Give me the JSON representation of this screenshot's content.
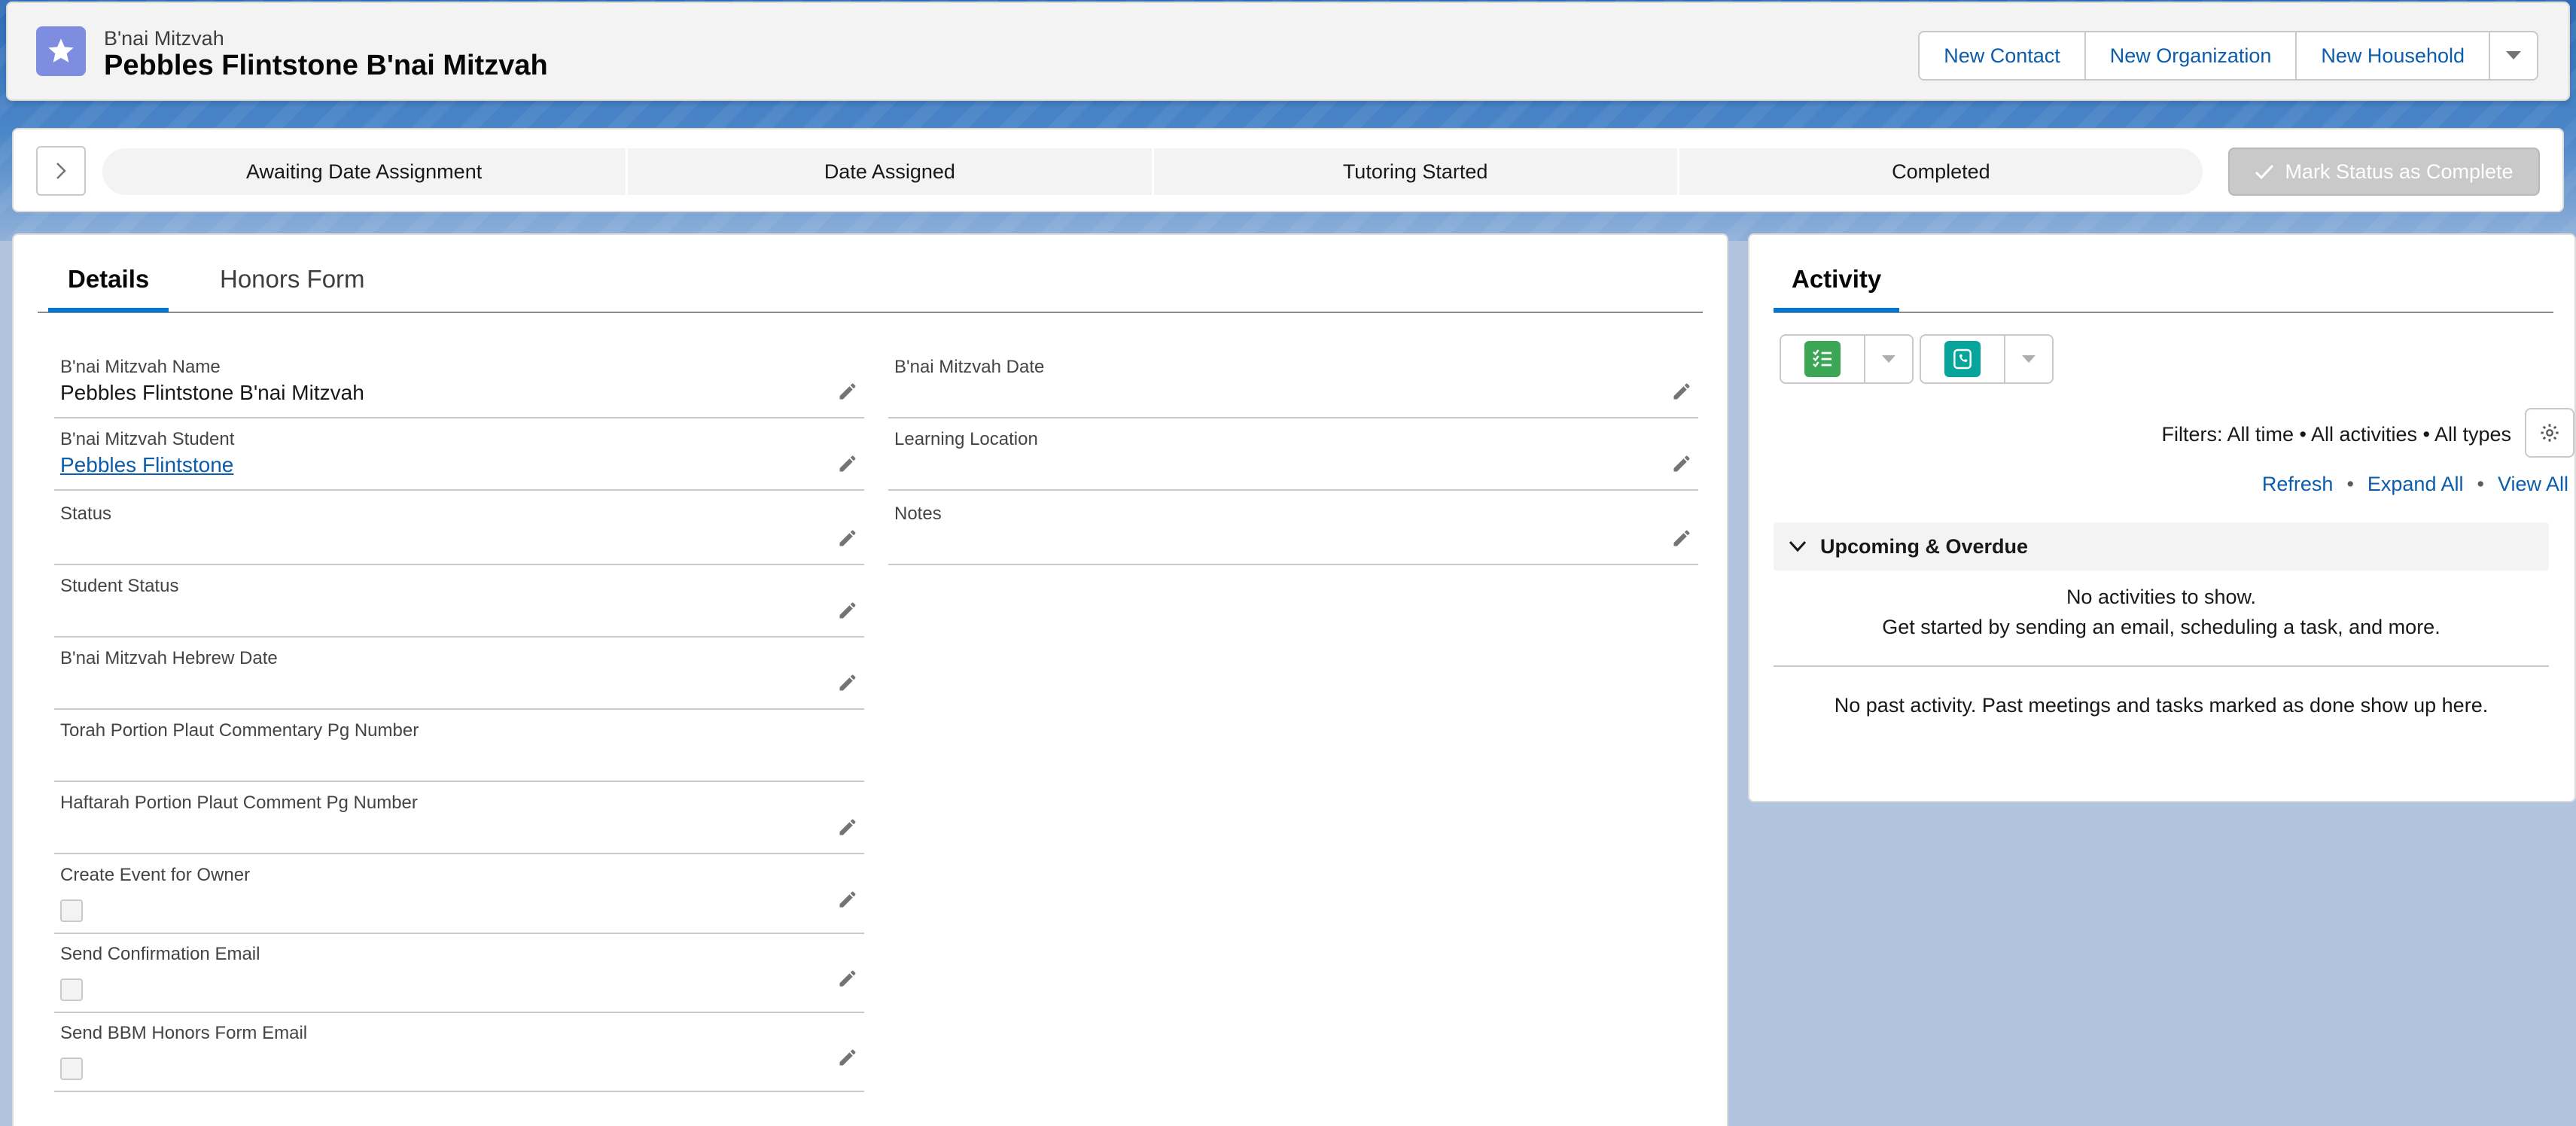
{
  "header": {
    "object_type": "B'nai Mitzvah",
    "record_title": "Pebbles Flintstone B'nai Mitzvah",
    "actions": [
      "New Contact",
      "New Organization",
      "New Household"
    ],
    "icon": "star-icon",
    "icon_color": "#7f8de1"
  },
  "path": {
    "stages": [
      "Awaiting Date Assignment",
      "Date Assigned",
      "Tutoring Started",
      "Completed"
    ],
    "mark_complete_label": "Mark Status as Complete"
  },
  "details": {
    "tabs": [
      "Details",
      "Honors Form"
    ],
    "left_fields": [
      {
        "label": "B'nai Mitzvah Name",
        "value": "Pebbles Flintstone B'nai Mitzvah"
      },
      {
        "label": "B'nai Mitzvah Student",
        "value": "Pebbles Flintstone"
      },
      {
        "label": "Status",
        "value": ""
      },
      {
        "label": "Student Status",
        "value": ""
      },
      {
        "label": "B'nai Mitzvah Hebrew Date",
        "value": ""
      },
      {
        "label": "Torah Portion Plaut Commentary Pg Number",
        "value": ""
      },
      {
        "label": "Haftarah Portion Plaut Comment Pg Number",
        "value": ""
      },
      {
        "label": "Create Event for Owner",
        "checked": false
      },
      {
        "label": "Send Confirmation Email",
        "checked": false
      },
      {
        "label": "Send BBM Honors Form Email",
        "checked": false
      }
    ],
    "right_fields": [
      {
        "label": "B'nai Mitzvah Date",
        "value": ""
      },
      {
        "label": "Learning Location",
        "value": ""
      },
      {
        "label": "Notes",
        "value": ""
      }
    ]
  },
  "activity": {
    "title": "Activity",
    "buttons": [
      {
        "icon": "new-task-icon",
        "color": "#3ba755"
      },
      {
        "icon": "log-call-icon",
        "color": "#06a59a"
      }
    ],
    "filters_text": "Filters: All time • All activities • All types",
    "links": [
      "Refresh",
      "Expand All",
      "View All"
    ],
    "section_title": "Upcoming & Overdue",
    "empty_line1": "No activities to show.",
    "empty_line2": "Get started by sending an email, scheduling a task, and more.",
    "past_activity": "No past activity. Past meetings and tasks marked as done show up here."
  },
  "colors": {
    "link": "#0b5cab",
    "accent": "#0176d3"
  }
}
